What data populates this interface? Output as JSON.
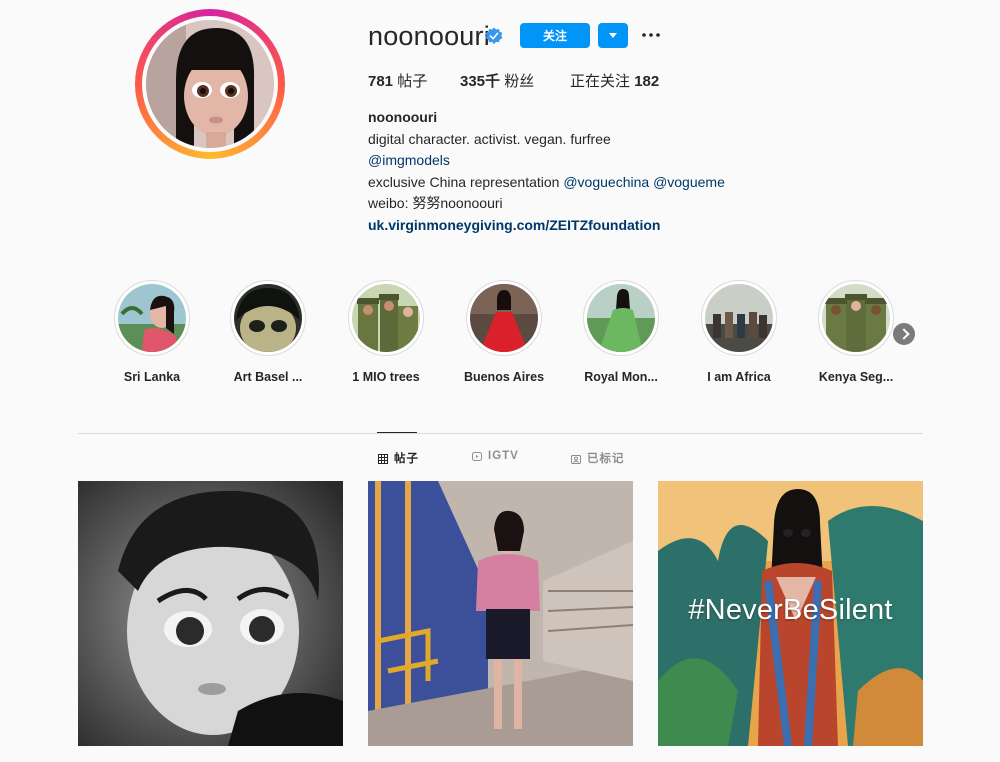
{
  "profile": {
    "username": "noonoouri",
    "verified": true,
    "follow_label": "关注",
    "more_icon": "more-horizontal-icon"
  },
  "stats": {
    "posts_count": "781",
    "posts_label": "帖子",
    "followers_count": "335千",
    "followers_label": "粉丝",
    "following_label": "正在关注",
    "following_count": "182"
  },
  "bio": {
    "name": "noonoouri",
    "line1": "digital character. activist. vegan. furfree",
    "line2_link": "@imgmodels",
    "line3_text": "exclusive China representation ",
    "line3_link1": "@voguechina",
    "line3_link2": "@vogueme",
    "line4": "weibo: 努努noonoouri",
    "website": "uk.virginmoneygiving.com/ZEITZfoundation"
  },
  "highlights": [
    {
      "label": "Sri Lanka"
    },
    {
      "label": "Art Basel ..."
    },
    {
      "label": "1 MIO trees"
    },
    {
      "label": "Buenos Aires"
    },
    {
      "label": "Royal Mon..."
    },
    {
      "label": "I am Africa"
    },
    {
      "label": "Kenya Seg..."
    }
  ],
  "tabs": [
    {
      "label": "帖子",
      "icon": "grid-icon",
      "active": true
    },
    {
      "label": "IGTV",
      "icon": "igtv-icon",
      "active": false
    },
    {
      "label": "已标记",
      "icon": "tagged-icon",
      "active": false
    }
  ],
  "posts": [
    {
      "caption": ""
    },
    {
      "caption": ""
    },
    {
      "caption": "#NeverBeSilent"
    }
  ],
  "colors": {
    "accent": "#0095f6",
    "link": "#00376b",
    "verified": "#3897f0"
  }
}
